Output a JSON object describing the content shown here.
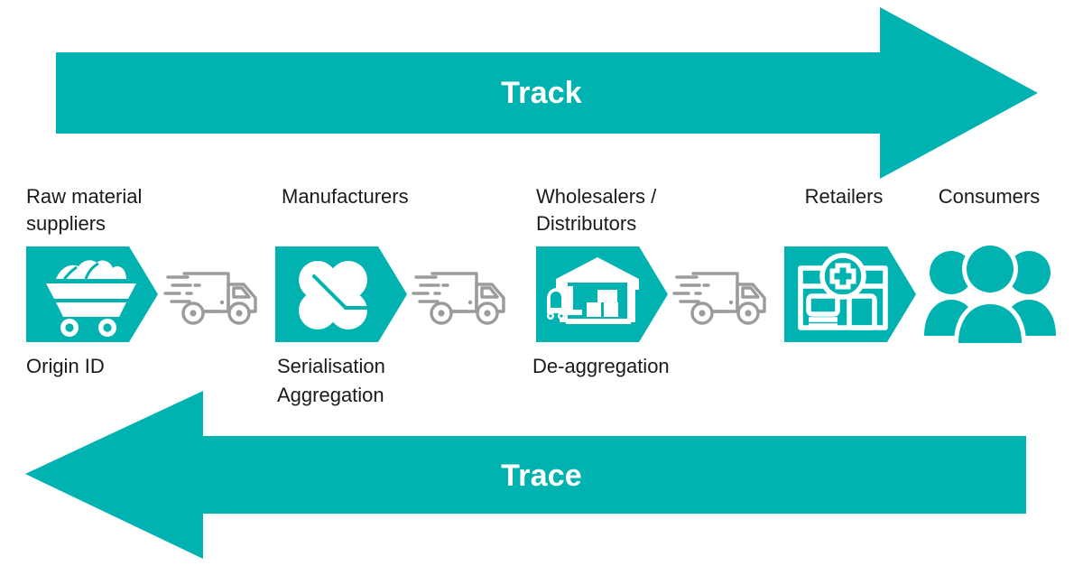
{
  "diagram": {
    "title_track": "Track",
    "title_trace": "Trace",
    "accent_color": "#00B2B0",
    "text_color": "#1a1a1a",
    "truck_color": "#9b9b9b",
    "background": "#ffffff"
  },
  "arrows": [
    {
      "name": "track",
      "label": "Track",
      "direction": "right"
    },
    {
      "name": "trace",
      "label": "Trace",
      "direction": "left"
    }
  ],
  "stages": [
    {
      "id": "raw-material-suppliers",
      "label": "Raw material\nsuppliers",
      "sublabel": "Origin ID",
      "icon": "mine-cart-icon"
    },
    {
      "id": "manufacturers",
      "label": "Manufacturers",
      "sublabel": "Serialisation\nAggregation",
      "icon": "capsules-icon"
    },
    {
      "id": "wholesalers-distributors",
      "label": "Wholesalers /\nDistributors",
      "sublabel": "De-aggregation",
      "icon": "warehouse-icon"
    },
    {
      "id": "retailers",
      "label": "Retailers",
      "sublabel": "",
      "icon": "pharmacy-icon"
    },
    {
      "id": "consumers",
      "label": "Consumers",
      "sublabel": "",
      "icon": "people-group-icon"
    }
  ],
  "connectors": [
    {
      "id": "truck-1",
      "icon": "delivery-truck-icon"
    },
    {
      "id": "truck-2",
      "icon": "delivery-truck-icon"
    },
    {
      "id": "truck-3",
      "icon": "delivery-truck-icon"
    }
  ]
}
